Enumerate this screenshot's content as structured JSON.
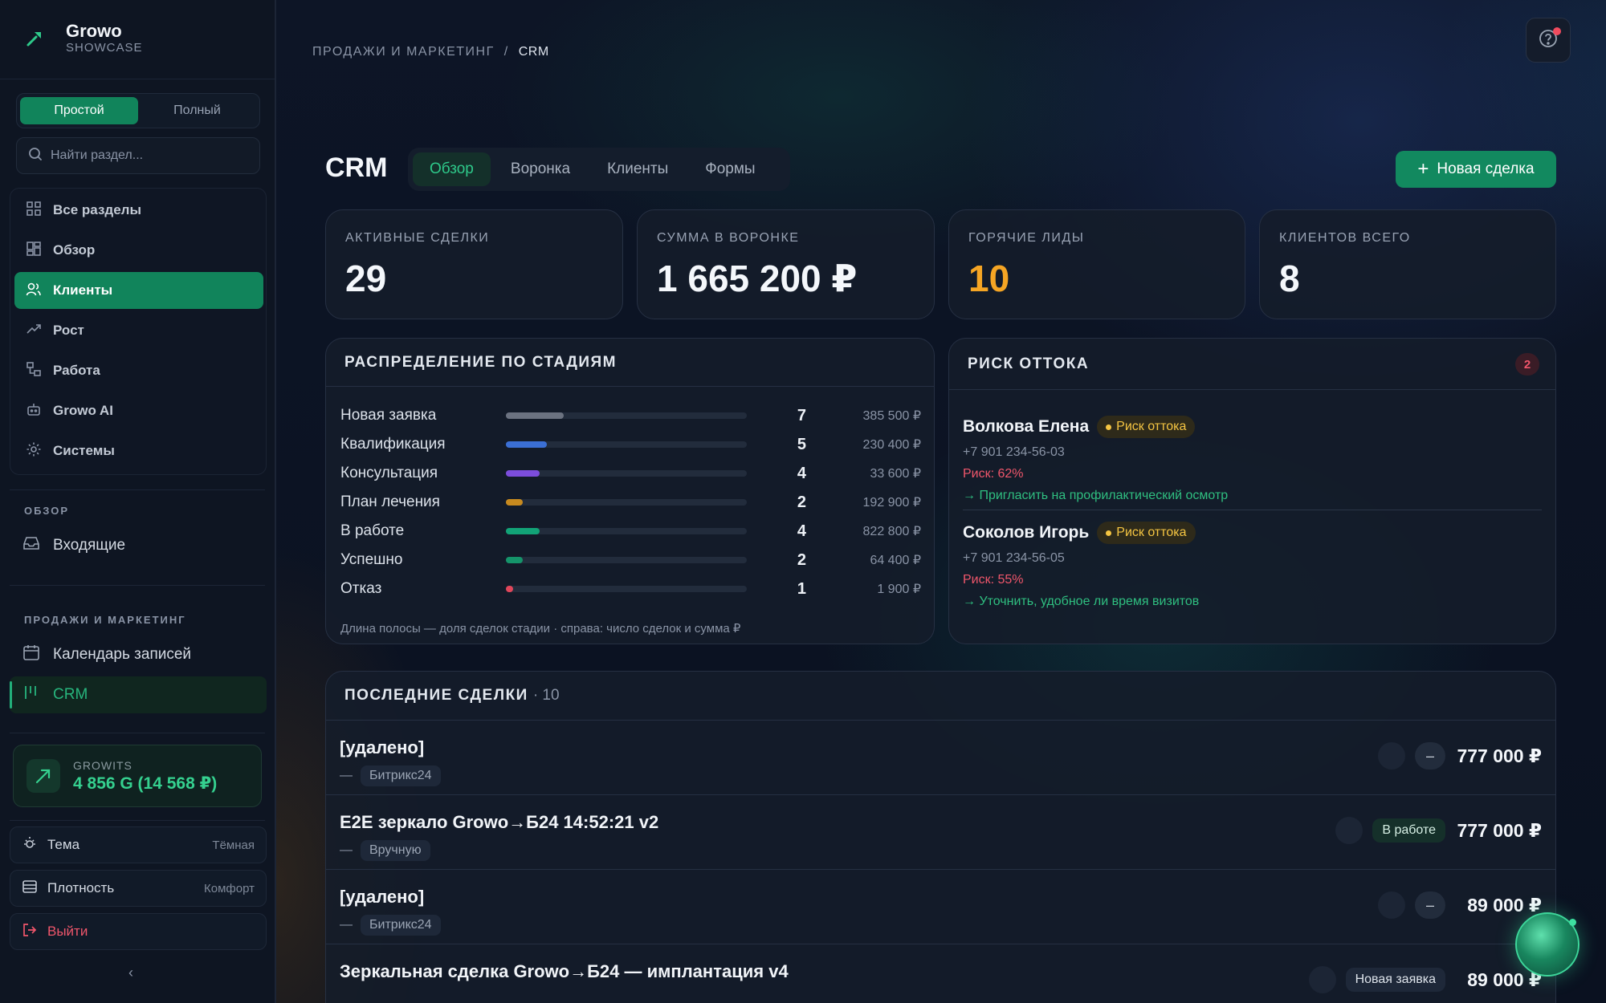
{
  "brand": {
    "name": "Growo",
    "sub": "SHOWCASE"
  },
  "mode": {
    "simple": "Простой",
    "full": "Полный"
  },
  "search": {
    "placeholder": "Найти раздел..."
  },
  "nav": {
    "items": [
      {
        "label": "Все разделы",
        "icon": "grid-icon"
      },
      {
        "label": "Обзор",
        "icon": "dashboard-icon"
      },
      {
        "label": "Клиенты",
        "icon": "users-icon"
      },
      {
        "label": "Рост",
        "icon": "trend-icon"
      },
      {
        "label": "Работа",
        "icon": "workflow-icon"
      },
      {
        "label": "Growo AI",
        "icon": "robot-icon"
      },
      {
        "label": "Системы",
        "icon": "gear-icon"
      }
    ]
  },
  "sections": {
    "overview": {
      "label": "ОБЗОР",
      "items": [
        {
          "label": "Входящие"
        }
      ]
    },
    "sales": {
      "label": "ПРОДАЖИ И МАРКЕТИНГ",
      "items": [
        {
          "label": "Календарь записей"
        },
        {
          "label": "CRM"
        }
      ]
    }
  },
  "growits": {
    "label": "GROWITS",
    "value": "4 856 G (14 568 ₽)"
  },
  "settings": {
    "theme": {
      "label": "Тема",
      "value": "Тёмная"
    },
    "density": {
      "label": "Плотность",
      "value": "Комфорт"
    },
    "logout": {
      "label": "Выйти"
    }
  },
  "breadcrumb": {
    "parent": "ПРОДАЖИ И МАРКЕТИНГ",
    "sep": "/",
    "current": "CRM"
  },
  "page": {
    "title": "CRM",
    "tabs": [
      "Обзор",
      "Воронка",
      "Клиенты",
      "Формы"
    ],
    "new_deal": "Новая сделка"
  },
  "kpis": [
    {
      "label": "АКТИВНЫЕ СДЕЛКИ",
      "value": "29"
    },
    {
      "label": "СУММА В ВОРОНКЕ",
      "value": "1 665 200 ₽"
    },
    {
      "label": "ГОРЯЧИЕ ЛИДЫ",
      "value": "10"
    },
    {
      "label": "КЛИЕНТОВ ВСЕГО",
      "value": "8"
    }
  ],
  "stages": {
    "title": "РАСПРЕДЕЛЕНИЕ ПО СТАДИЯМ",
    "rows": [
      {
        "name": "Новая заявка",
        "count": "7",
        "sum": "385 500 ₽",
        "share": 0.24,
        "color": "#6b7280"
      },
      {
        "name": "Квалификация",
        "count": "5",
        "sum": "230 400 ₽",
        "share": 0.17,
        "color": "#3b6fd4"
      },
      {
        "name": "Консультация",
        "count": "4",
        "sum": "33 600 ₽",
        "share": 0.14,
        "color": "#7c4ddb"
      },
      {
        "name": "План лечения",
        "count": "2",
        "sum": "192 900 ₽",
        "share": 0.07,
        "color": "#c78a1f"
      },
      {
        "name": "В работе",
        "count": "4",
        "sum": "822 800 ₽",
        "share": 0.14,
        "color": "#12a377"
      },
      {
        "name": "Успешно",
        "count": "2",
        "sum": "64 400 ₽",
        "share": 0.07,
        "color": "#15946a"
      },
      {
        "name": "Отказ",
        "count": "1",
        "sum": "1 900 ₽",
        "share": 0.03,
        "color": "#e0465a"
      }
    ],
    "note": "Длина полосы — доля сделок стадии · справа: число сделок и сумма ₽"
  },
  "risk": {
    "title": "РИСК ОТТОКА",
    "count": "2",
    "items": [
      {
        "name": "Волкова Елена",
        "tag": "Риск оттока",
        "phone": "+7 901 234-56-03",
        "pct": "Риск: 62%",
        "action": "→ Пригласить на профилактический осмотр"
      },
      {
        "name": "Соколов Игорь",
        "tag": "Риск оттока",
        "phone": "+7 901 234-56-05",
        "pct": "Риск: 55%",
        "action": "→ Уточнить, удобное ли время визитов"
      }
    ]
  },
  "deals": {
    "title": "ПОСЛЕДНИЕ СДЕЛКИ",
    "count": "· 10",
    "rows": [
      {
        "title": "[удалено]",
        "dash": "—",
        "source": "Битрикс24",
        "stage": "–",
        "amount": "777 000 ₽"
      },
      {
        "title": "E2E зеркало Growo→Б24 14:52:21 v2",
        "dash": "—",
        "source": "Вручную",
        "stage": "В работе",
        "amount": "777 000 ₽"
      },
      {
        "title": "[удалено]",
        "dash": "—",
        "source": "Битрикс24",
        "stage": "–",
        "amount": "89 000 ₽"
      },
      {
        "title": "Зеркальная сделка Growo→Б24 — имплантация v4",
        "dash": "—",
        "source": "",
        "stage": "Новая заявка",
        "amount": "89 000 ₽"
      }
    ]
  }
}
